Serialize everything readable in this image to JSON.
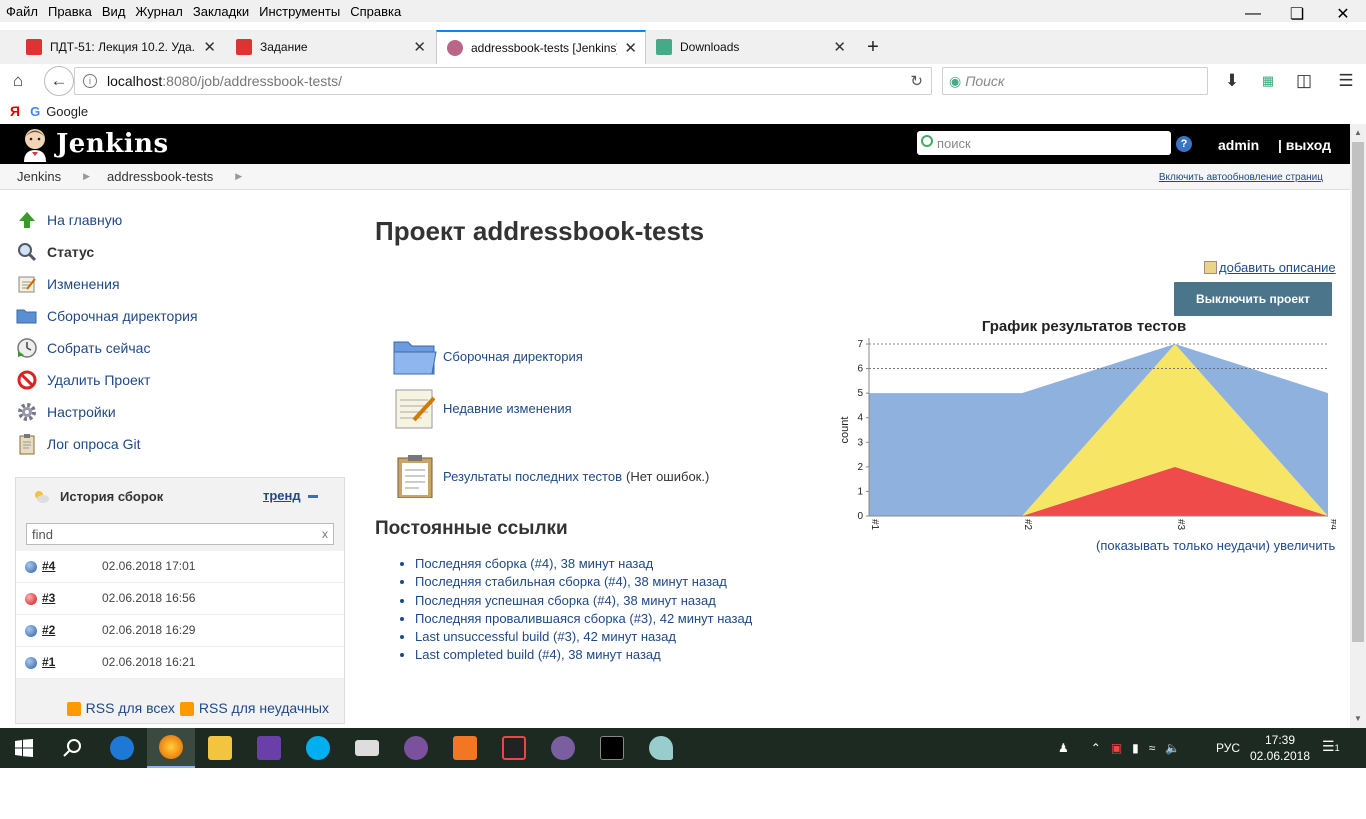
{
  "menu": [
    "Файл",
    "Правка",
    "Вид",
    "Журнал",
    "Закладки",
    "Инструменты",
    "Справка"
  ],
  "tabs": [
    {
      "label": "ПДТ-51: Лекция 10.2. Уда...",
      "color": "#d33"
    },
    {
      "label": "Задание",
      "color": "#d33"
    },
    {
      "label": "addressbook-tests [Jenkins]",
      "color": "#b68"
    },
    {
      "label": "Downloads",
      "color": "#4a8"
    }
  ],
  "url": {
    "host": "localhost",
    "path": ":8080/job/addressbook-tests/"
  },
  "browser_search_placeholder": "Поиск",
  "bookmarks": {
    "ya": "Я",
    "google": "Google"
  },
  "jenkins": {
    "title": "Jenkins",
    "search_placeholder": "поиск",
    "help": "?",
    "user": "admin",
    "logout": "| выход"
  },
  "breadcrumbs": {
    "items": [
      "Jenkins",
      "addressbook-tests"
    ],
    "autorefresh": "Включить автообновление страниц"
  },
  "sidebar": {
    "tasks": [
      {
        "label": "На главную",
        "icon": "up-arrow-icon"
      },
      {
        "label": "Статус",
        "icon": "magnifier-icon"
      },
      {
        "label": "Изменения",
        "icon": "notepad-icon"
      },
      {
        "label": "Сборочная директория",
        "icon": "folder-icon"
      },
      {
        "label": "Собрать сейчас",
        "icon": "build-now-icon"
      },
      {
        "label": "Удалить Проект",
        "icon": "no-entry-icon"
      },
      {
        "label": "Настройки",
        "icon": "gear-icon"
      },
      {
        "label": "Лог опроса Git",
        "icon": "clipboard-icon"
      }
    ]
  },
  "history": {
    "title": "История сборок",
    "trend": "тренд",
    "filter_value": "find",
    "filter_clear": "x",
    "builds": [
      {
        "num": "#4",
        "date": "02.06.2018 17:01",
        "status": "blue"
      },
      {
        "num": "#3",
        "date": "02.06.2018 16:56",
        "status": "red"
      },
      {
        "num": "#2",
        "date": "02.06.2018 16:29",
        "status": "blue"
      },
      {
        "num": "#1",
        "date": "02.06.2018 16:21",
        "status": "blue"
      }
    ],
    "rss_all": "RSS для всех",
    "rss_failed": "RSS для неудачных"
  },
  "main": {
    "title": "Проект addressbook-tests",
    "add_description": "добавить описание",
    "disable_button": "Выключить проект",
    "links": [
      {
        "label": "Сборочная директория",
        "tail": ""
      },
      {
        "label": "Недавние изменения",
        "tail": ""
      },
      {
        "label": "Результаты последних тестов",
        "tail": "(Нет ошибок.)"
      }
    ],
    "permalinks_title": "Постоянные ссылки",
    "permalinks": [
      "Последняя сборка (#4), 38 минут назад",
      "Последняя стабильная сборка (#4), 38 минут назад",
      "Последняя успешная сборка (#4), 38 минут назад",
      "Последняя провалившаяся сборка (#3), 42 минут назад",
      "Last unsuccessful build (#3), 42 минут назад",
      "Last completed build (#4), 38 минут назад"
    ],
    "chart_links": {
      "only_failures": "(показывать только неудачи)",
      "enlarge": "увеличить"
    }
  },
  "chart_data": {
    "type": "area",
    "title": "График результатов тестов",
    "xlabel": "",
    "ylabel": "count",
    "categories": [
      "#1",
      "#2",
      "#3",
      "#4"
    ],
    "ylim": [
      0,
      7
    ],
    "yticks": [
      0,
      1,
      2,
      3,
      4,
      5,
      6,
      7
    ],
    "gridlines": [
      6,
      7
    ],
    "stacked": true,
    "series": [
      {
        "values": [
          0,
          0,
          2,
          0
        ],
        "color": "#ef4b4b"
      },
      {
        "values": [
          0,
          0,
          5,
          0
        ],
        "color": "#f7e566"
      },
      {
        "values": [
          5,
          5,
          0,
          5
        ],
        "color": "#8fb1de"
      }
    ]
  },
  "taskbar": {
    "lang": "РУС",
    "time": "17:39",
    "date": "02.06.2018",
    "notif": "1"
  }
}
